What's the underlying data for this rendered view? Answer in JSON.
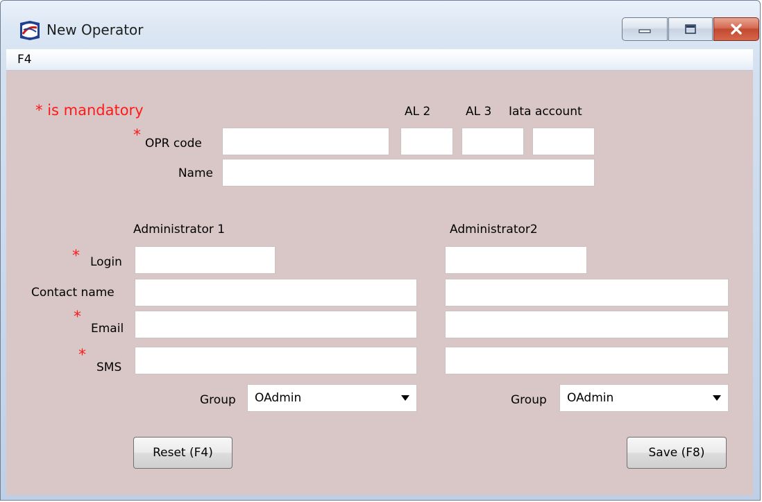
{
  "window": {
    "title": "New Operator",
    "menu": {
      "f4_label": "F4"
    }
  },
  "form": {
    "mandatory_note": "is mandatory",
    "required_marker": "*",
    "col_al2": "AL 2",
    "col_al3": "AL 3",
    "col_iata": "Iata account",
    "opr_code_label": "OPR code",
    "name_label": "Name",
    "admin1_heading": "Administrator 1",
    "admin2_heading": "Administrator2",
    "login_label": "Login",
    "contact_name_label": "Contact name",
    "email_label": "Email",
    "sms_label": "SMS",
    "group_label": "Group",
    "admin1_group_value": "OAdmin",
    "admin2_group_value": "OAdmin",
    "fields": {
      "opr_code": "",
      "al2": "",
      "al3": "",
      "iata_account": "",
      "name": "",
      "admin1_login": "",
      "admin1_contact_name": "",
      "admin1_email": "",
      "admin1_sms": "",
      "admin2_login": "",
      "admin2_contact_name": "",
      "admin2_email": "",
      "admin2_sms": ""
    }
  },
  "buttons": {
    "reset_label": "Reset (F4)",
    "save_label": "Save (F8)"
  },
  "colors": {
    "form_background": "#d8c7c6",
    "required_red": "#ff1a1a",
    "close_button_red": "#c14a2f"
  },
  "icons": {
    "app": "app-logo-icon",
    "minimize": "minimize-icon",
    "maximize": "maximize-icon",
    "close": "close-icon",
    "dropdown": "chevron-down-icon"
  }
}
